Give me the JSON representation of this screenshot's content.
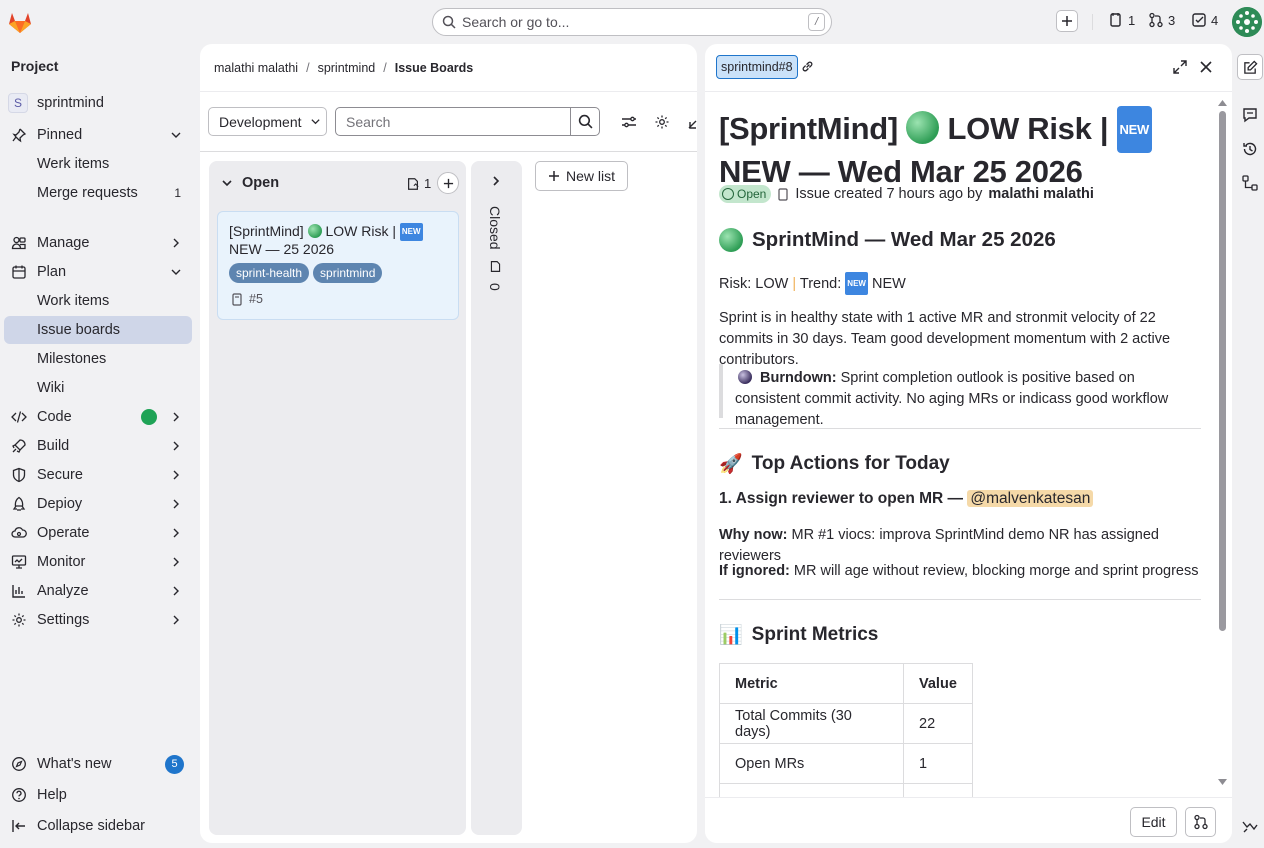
{
  "topbar": {
    "search_placeholder": "Search or go to...",
    "search_shortcut": "/",
    "issues_count": "1",
    "merge_requests_count": "3",
    "todos_count": "4"
  },
  "sidebar": {
    "section_title": "Project",
    "project": {
      "avatar_letter": "S",
      "name": "sprintmind"
    },
    "pinned": {
      "label": "Pinned",
      "items": [
        {
          "label": "Werk items"
        },
        {
          "label": "Merge requests",
          "badge": "1"
        }
      ]
    },
    "manage": "Manage",
    "plan": {
      "label": "Plan",
      "items": [
        {
          "label": "Work items"
        },
        {
          "label": "Issue boards"
        },
        {
          "label": "Milestones"
        },
        {
          "label": "Wiki"
        }
      ]
    },
    "code": "Code",
    "build": "Build",
    "secure": "Secure",
    "deploy": "Depioy",
    "operate": "Operate",
    "monitor": "Monitor",
    "analyze": "Analyze",
    "settings": "Settings",
    "whats_new": {
      "label": "What's new",
      "badge": "5"
    },
    "help": "Help",
    "collapse": "Collapse sidebar"
  },
  "board": {
    "breadcrumbs": [
      "malathi malathi",
      "sprintmind",
      "Issue Boards"
    ],
    "board_select": "Development",
    "search_placeholder": "Search",
    "open_list": {
      "title": "Open",
      "count": "1",
      "card": {
        "title_a": "[SprintMind] ",
        "title_b": " LOW Risk | ",
        "title_c": " NEW — 25 2026",
        "new_tag": "NEW",
        "labels": [
          "sprint-health",
          "sprintmind"
        ],
        "id": "#5"
      }
    },
    "closed_list": {
      "title": "Closed",
      "count": "0"
    },
    "new_list": "New list"
  },
  "detail": {
    "reference": "sprintmind#8",
    "title_a": "[SprintMind] ",
    "title_b": " LOW Risk | ",
    "title_c": " NEW — Wed Mar 25 2026",
    "new_tag": "NEW",
    "status": "Open",
    "meta_text": "Issue created 7 hours ago by",
    "author": "malathi malathi",
    "heading1": "SprintMind — Wed Mar 25 2026",
    "risk_label": "Risk:",
    "risk_value": "LOW",
    "trend_label": "Trend:",
    "trend_value": "NEW",
    "summary": "Sprint is in healthy state with 1 active MR and stronmit velocity of 22 commits in 30 days. Team good development momentum with 2 active contributors.",
    "burndown_label": "Burndown:",
    "burndown_text": "Sprint completion outlook is positive based on consistent commit activity. No aging MRs or indicass good workflow management.",
    "heading2_emoji": "🚀",
    "heading2": "Top Actions for Today",
    "action1": "1. Assign reviewer to open MR —",
    "action1_mention": "@malvenkatesan",
    "why_label": "Why now:",
    "why_text": "MR #1 viocs: improva SprintMind demo NR has assigned reviewers",
    "ignored_label": "If ignored:",
    "ignored_text": "MR will age without review, blocking morge and sprint progress",
    "heading3_emoji": "📊",
    "heading3": "Sprint Metrics",
    "metrics_headers": [
      "Metric",
      "Value"
    ],
    "metrics_rows": [
      [
        "Total Commits (30 days)",
        "22"
      ],
      [
        "Open MRs",
        "1"
      ]
    ],
    "edit_button": "Edit"
  },
  "colors": {
    "accent": "#1f75cb",
    "active_nav": "#cfd6e8",
    "label_pill": "#5e85b0",
    "open_badge": "#c3e6cd"
  }
}
